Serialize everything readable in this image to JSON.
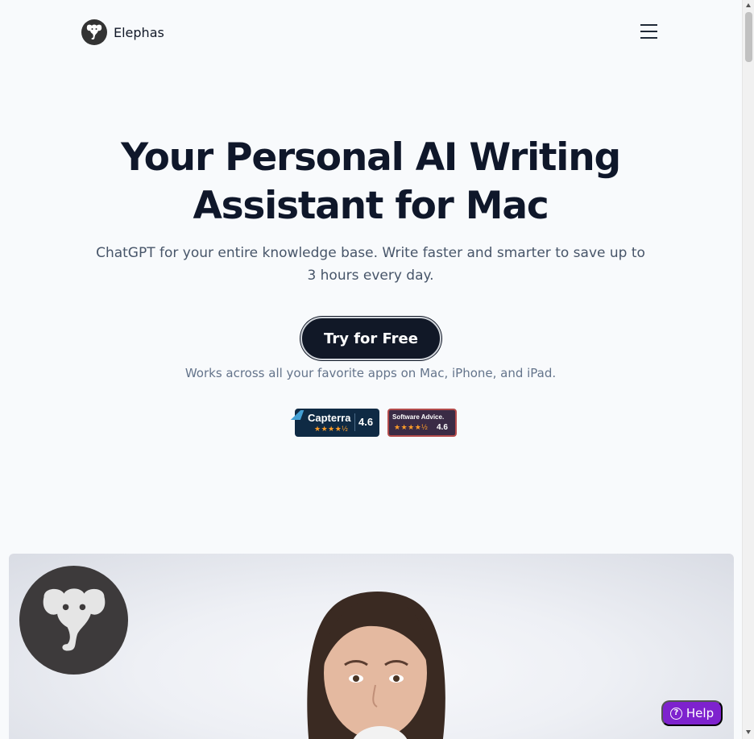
{
  "header": {
    "brand": "Elephas",
    "logo_icon": "elephant-logo-icon",
    "menu_icon": "hamburger-menu-icon"
  },
  "hero": {
    "title_line1": "Your Personal AI Writing",
    "title_line2": "Assistant for Mac",
    "subtitle_line1": "ChatGPT for your entire knowledge base. Write faster and smarter to save up to",
    "subtitle_line2": "3 hours every day.",
    "cta_label": "Try for Free",
    "works_text": "Works across all your favorite apps on Mac, iPhone, and iPad."
  },
  "badges": {
    "capterra": {
      "name": "Capterra",
      "rating": "4.6",
      "stars": "★★★★½"
    },
    "software_advice": {
      "name": "Software Advice.",
      "rating": "4.6",
      "stars": "★★★★½"
    }
  },
  "help": {
    "label": "Help",
    "icon": "question-circle-icon"
  },
  "colors": {
    "background": "#f8fafc",
    "cta_bg": "#111827",
    "help_bg": "#7e22ce",
    "star": "#ff9d28"
  }
}
